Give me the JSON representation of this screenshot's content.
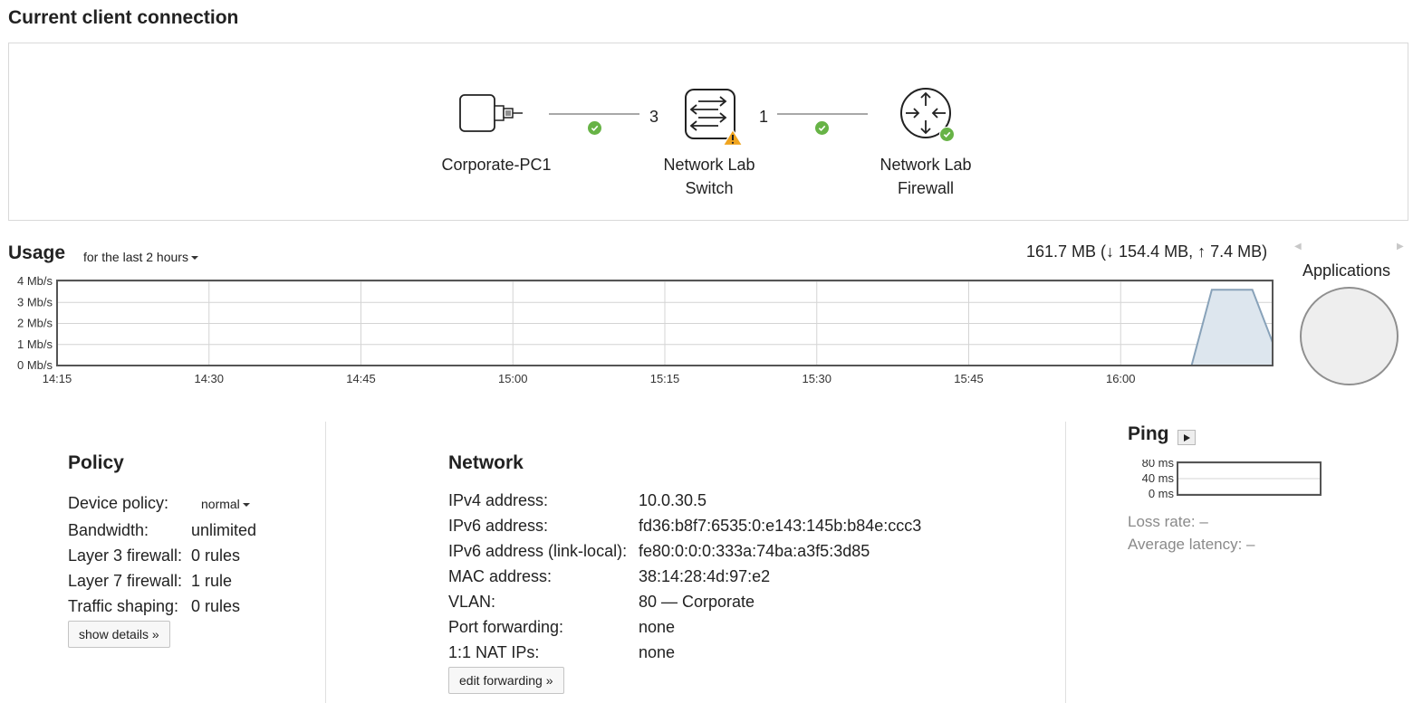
{
  "header": {
    "title": "Current client connection"
  },
  "topology": {
    "devices": [
      {
        "name": "Corporate-PC1",
        "icon": "desktop-icon"
      },
      {
        "name_line1": "Network Lab",
        "name_line2": "Switch",
        "icon": "switch-icon",
        "badge": "warning-icon"
      },
      {
        "name_line1": "Network Lab",
        "name_line2": "Firewall",
        "icon": "router-icon",
        "badge": "check-icon"
      }
    ],
    "links": [
      {
        "port_right": "3",
        "status": "ok"
      },
      {
        "port_left": "1",
        "status": "ok"
      }
    ]
  },
  "usage": {
    "title": "Usage",
    "range": "for the last 2 hours",
    "total": "161.7 MB (↓ 154.4 MB, ↑ 7.4 MB)",
    "applications_label": "Applications"
  },
  "chart_data": {
    "type": "area",
    "title": "",
    "xlabel": "",
    "ylabel": "",
    "y_ticks": [
      "0 Mb/s",
      "1 Mb/s",
      "2 Mb/s",
      "3 Mb/s",
      "4 Mb/s"
    ],
    "ylim": [
      0,
      4
    ],
    "x_tick_labels": [
      "14:15",
      "14:30",
      "14:45",
      "15:00",
      "15:15",
      "15:30",
      "15:45",
      "16:00"
    ],
    "xlim": [
      "14:15",
      "16:15"
    ],
    "grid": true,
    "series": [
      {
        "x": [
          "15:57",
          "16:07",
          "16:09",
          "16:13",
          "16:15"
        ],
        "values": [
          0.0,
          0.0,
          3.6,
          3.6,
          1.1
        ]
      }
    ],
    "colors": {
      "fill": "#dde6ee",
      "line": "#88a2b9",
      "grid": "#d4d4d4",
      "border": "#555555"
    }
  },
  "policy": {
    "title": "Policy",
    "rows": [
      {
        "label": "Device policy:",
        "value": "normal"
      },
      {
        "label": "Bandwidth:",
        "value": "unlimited"
      },
      {
        "label": "Layer 3 firewall:",
        "value": "0 rules"
      },
      {
        "label": "Layer 7 firewall:",
        "value": "1 rule"
      },
      {
        "label": "Traffic shaping:",
        "value": "0 rules"
      }
    ],
    "button": "show details »"
  },
  "network": {
    "title": "Network",
    "rows": [
      {
        "label": "IPv4 address:",
        "value": "10.0.30.5"
      },
      {
        "label": "IPv6 address:",
        "value": "fd36:b8f7:6535:0:e143:145b:b84e:ccc3"
      },
      {
        "label": "IPv6 address (link-local):",
        "value": "fe80:0:0:0:333a:74ba:a3f5:3d85"
      },
      {
        "label": "MAC address:",
        "value": "38:14:28:4d:97:e2"
      },
      {
        "label": "VLAN:",
        "value": "80 — Corporate"
      },
      {
        "label": "Port forwarding:",
        "value": "none"
      },
      {
        "label": "1:1 NAT IPs:",
        "value": "none"
      }
    ],
    "button": "edit forwarding »"
  },
  "ping": {
    "title": "Ping",
    "y_ticks": [
      "80 ms",
      "40 ms",
      "0 ms"
    ],
    "loss_rate": "Loss rate: –",
    "avg_latency": "Average latency: –"
  },
  "colors": {
    "ok": "#67b346",
    "warning": "#f0a41e",
    "text": "#222222",
    "muted": "#8a8a8a"
  }
}
